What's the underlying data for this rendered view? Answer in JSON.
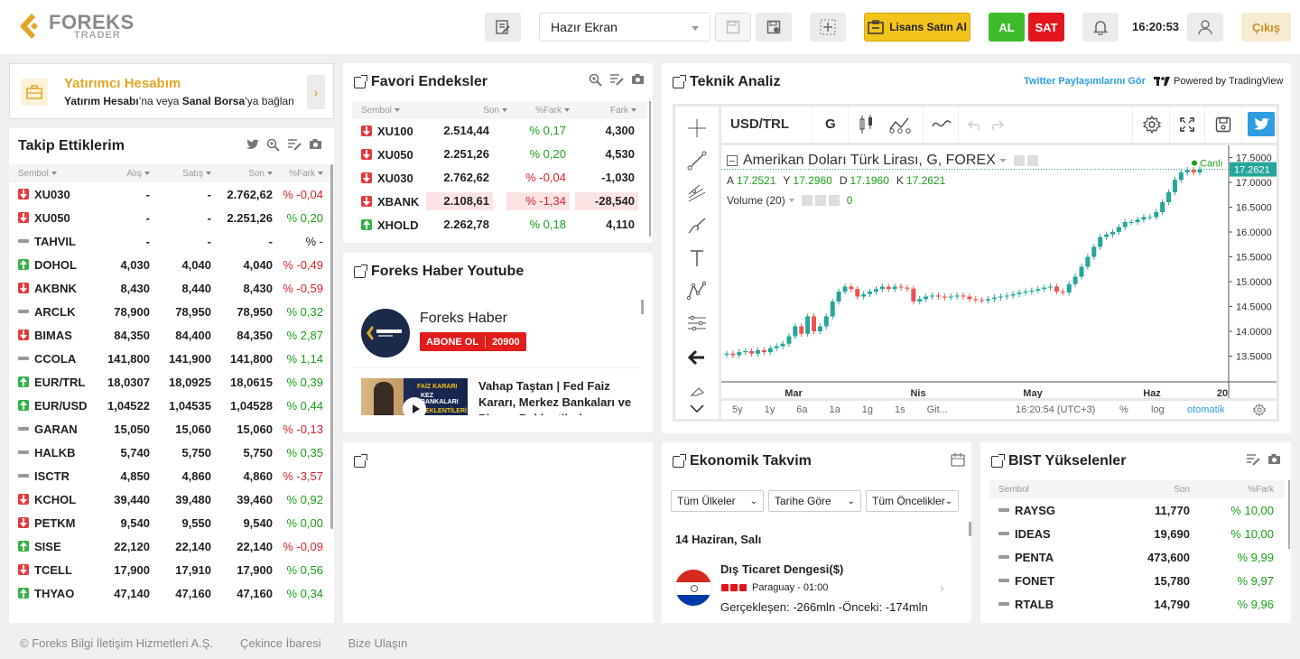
{
  "header": {
    "logo_main": "FOREKS",
    "logo_sub": "TRADER",
    "screen_select": "Hazır Ekran",
    "license_button": "Lisans Satın Al",
    "buy_button": "AL",
    "sell_button": "SAT",
    "clock": "16:20:53",
    "logout": "Çıkış",
    "colors": {
      "buy": "#3dbb2b",
      "sell": "#e3151e",
      "license": "#f2c31a",
      "gold": "#e0a526"
    }
  },
  "investor": {
    "title": "Yatırımcı Hesabım",
    "desc_part1": "Yatırım Hesabı",
    "desc_part2": "’na veya ",
    "desc_part3": "Sanal Borsa",
    "desc_part4": "’ya bağlan"
  },
  "watchlist": {
    "title": "Takip Ettiklerim",
    "columns": [
      "Sembol",
      "Alış",
      "Satış",
      "Son",
      "%Fark"
    ],
    "rows": [
      {
        "dir": "dn",
        "symbol": "XU030",
        "bid": "-",
        "ask": "-",
        "last": "2.762,62",
        "pct": "% -0,04",
        "sign": "neg"
      },
      {
        "dir": "dn",
        "symbol": "XU050",
        "bid": "-",
        "ask": "-",
        "last": "2.251,26",
        "pct": "% 0,20",
        "sign": "pos"
      },
      {
        "dir": "eq",
        "symbol": "TAHVIL",
        "bid": "-",
        "ask": "-",
        "last": "-",
        "pct": "% -",
        "sign": "flat"
      },
      {
        "dir": "up",
        "symbol": "DOHOL",
        "bid": "4,030",
        "ask": "4,040",
        "last": "4,040",
        "pct": "% -0,49",
        "sign": "neg"
      },
      {
        "dir": "dn",
        "symbol": "AKBNK",
        "bid": "8,430",
        "ask": "8,440",
        "last": "8,430",
        "pct": "% -0,59",
        "sign": "neg"
      },
      {
        "dir": "eq",
        "symbol": "ARCLK",
        "bid": "78,900",
        "ask": "78,950",
        "last": "78,950",
        "pct": "% 0,32",
        "sign": "pos"
      },
      {
        "dir": "dn",
        "symbol": "BIMAS",
        "bid": "84,350",
        "ask": "84,400",
        "last": "84,350",
        "pct": "% 2,87",
        "sign": "pos"
      },
      {
        "dir": "eq",
        "symbol": "CCOLA",
        "bid": "141,800",
        "ask": "141,900",
        "last": "141,800",
        "pct": "% 1,14",
        "sign": "pos"
      },
      {
        "dir": "up",
        "symbol": "EUR/TRL",
        "bid": "18,0307",
        "ask": "18,0925",
        "last": "18,0615",
        "pct": "% 0,39",
        "sign": "pos"
      },
      {
        "dir": "up",
        "symbol": "EUR/USD",
        "bid": "1,04522",
        "ask": "1,04535",
        "last": "1,04528",
        "pct": "% 0,44",
        "sign": "pos"
      },
      {
        "dir": "eq",
        "symbol": "GARAN",
        "bid": "15,050",
        "ask": "15,060",
        "last": "15,060",
        "pct": "% -0,13",
        "sign": "neg"
      },
      {
        "dir": "eq",
        "symbol": "HALKB",
        "bid": "5,740",
        "ask": "5,750",
        "last": "5,750",
        "pct": "% 0,35",
        "sign": "pos"
      },
      {
        "dir": "eq",
        "symbol": "ISCTR",
        "bid": "4,850",
        "ask": "4,860",
        "last": "4,860",
        "pct": "% -3,57",
        "sign": "neg"
      },
      {
        "dir": "dn",
        "symbol": "KCHOL",
        "bid": "39,440",
        "ask": "39,480",
        "last": "39,460",
        "pct": "% 0,92",
        "sign": "pos"
      },
      {
        "dir": "dn",
        "symbol": "PETKM",
        "bid": "9,540",
        "ask": "9,550",
        "last": "9,540",
        "pct": "% 0,00",
        "sign": "pos"
      },
      {
        "dir": "up",
        "symbol": "SISE",
        "bid": "22,120",
        "ask": "22,140",
        "last": "22,140",
        "pct": "% -0,09",
        "sign": "neg"
      },
      {
        "dir": "dn",
        "symbol": "TCELL",
        "bid": "17,900",
        "ask": "17,910",
        "last": "17,900",
        "pct": "% 0,56",
        "sign": "pos"
      },
      {
        "dir": "up",
        "symbol": "THYAO",
        "bid": "47,140",
        "ask": "47,160",
        "last": "47,160",
        "pct": "% 0,34",
        "sign": "pos"
      }
    ]
  },
  "favorites": {
    "title": "Favori Endeksler",
    "columns": [
      "Sembol",
      "Son",
      "%Fark",
      "Fark"
    ],
    "rows": [
      {
        "dir": "dn",
        "symbol": "XU100",
        "last": "2.514,44",
        "pct": "% 0,17",
        "diff": "4,300",
        "sign": "pos",
        "hl": false
      },
      {
        "dir": "dn",
        "symbol": "XU050",
        "last": "2.251,26",
        "pct": "% 0,20",
        "diff": "4,530",
        "sign": "pos",
        "hl": false
      },
      {
        "dir": "dn",
        "symbol": "XU030",
        "last": "2.762,62",
        "pct": "% -0,04",
        "diff": "-1,030",
        "sign": "neg",
        "hl": false
      },
      {
        "dir": "dn",
        "symbol": "XBANK",
        "last": "2.108,61",
        "pct": "% -1,34",
        "diff": "-28,540",
        "sign": "neg",
        "hl": true
      },
      {
        "dir": "up",
        "symbol": "XHOLD",
        "last": "2.262,78",
        "pct": "% 0,18",
        "diff": "4,110",
        "sign": "pos",
        "hl": false
      }
    ]
  },
  "youtube": {
    "title": "Foreks Haber Youtube",
    "channel": "Foreks Haber",
    "subscribe": "ABONE OL",
    "subs": "20900",
    "video_title": "Vahap Taştan | Fed Faiz Kararı, Merkez Bankaları ve Piyasa Beklentileri",
    "thumb_text1": "FAİZ KARARI",
    "thumb_text2": "KEZ BANKALARI",
    "thumb_text3": "A BEKLENTİLERİ"
  },
  "technical": {
    "title": "Teknik Analiz",
    "twitter_link": "Twitter Paylaşımlarını Gör",
    "powered": "Powered by TradingView",
    "symbol": "USD/TRL",
    "interval": "G",
    "chart_title": "Amerikan Doları Türk Lirası, G, FOREX",
    "ohlc": [
      {
        "k": "A",
        "v": "17.2521"
      },
      {
        "k": "Y",
        "v": "17.2960"
      },
      {
        "k": "D",
        "v": "17.1960"
      },
      {
        "k": "K",
        "v": "17.2621"
      }
    ],
    "volume_label": "Volume (20)",
    "volume_value": "0",
    "live_label": "Canlı",
    "last_price": "17.2621",
    "bottom": {
      "ranges": [
        "5y",
        "1y",
        "6a",
        "1a",
        "1g",
        "1s",
        "Git..."
      ],
      "time": "16:20:54 (UTC+3)",
      "pct": "%",
      "log": "log",
      "auto": "otomatik"
    }
  },
  "chart_data": {
    "type": "candlestick",
    "title": "Amerikan Doları Türk Lirası, G, FOREX",
    "x_tick_labels": [
      "Mar",
      "Nis",
      "May",
      "Haz",
      "20"
    ],
    "y_tick_labels": [
      "17.5000",
      "17.0000",
      "16.5000",
      "16.0000",
      "15.5000",
      "15.0000",
      "14.5000",
      "14.0000",
      "13.5000"
    ],
    "ylim": [
      13.2,
      17.6
    ],
    "approx_close": [
      13.55,
      13.52,
      13.58,
      13.6,
      13.55,
      13.62,
      13.58,
      13.66,
      13.7,
      13.75,
      13.9,
      14.1,
      13.95,
      14.3,
      14.0,
      14.1,
      14.3,
      14.6,
      14.8,
      14.9,
      14.85,
      14.7,
      14.75,
      14.8,
      14.85,
      14.9,
      14.85,
      14.9,
      14.88,
      14.86,
      14.6,
      14.65,
      14.7,
      14.72,
      14.7,
      14.68,
      14.7,
      14.72,
      14.7,
      14.65,
      14.63,
      14.62,
      14.65,
      14.68,
      14.7,
      14.72,
      14.75,
      14.78,
      14.8,
      14.82,
      14.85,
      14.88,
      14.9,
      14.8,
      14.78,
      14.95,
      15.1,
      15.3,
      15.5,
      15.7,
      15.9,
      15.95,
      16.0,
      16.1,
      16.2,
      16.2,
      16.25,
      16.3,
      16.3,
      16.4,
      16.6,
      16.8,
      17.05,
      17.2,
      17.25,
      17.2,
      17.26
    ]
  },
  "ekonomik": {
    "title": "Ekonomik Takvim",
    "filters": [
      "Tüm Ülkeler",
      "Tarihe Göre",
      "Tüm Öncelikler"
    ],
    "date": "14 Haziran, Salı",
    "event": "Dış Ticaret Dengesi($)",
    "country_time": "Paraguay - 01:00",
    "result": "Gerçekleşen: -266mln -Önceki: -174mln"
  },
  "rising": {
    "title": "BIST Yükselenler",
    "columns": [
      "Sembol",
      "Son",
      "%Fark"
    ],
    "rows": [
      {
        "symbol": "RAYSG",
        "last": "11,770",
        "pct": "% 10,00"
      },
      {
        "symbol": "IDEAS",
        "last": "19,690",
        "pct": "% 10,00"
      },
      {
        "symbol": "PENTA",
        "last": "473,600",
        "pct": "% 9,99"
      },
      {
        "symbol": "FONET",
        "last": "15,780",
        "pct": "% 9,97"
      },
      {
        "symbol": "RTALB",
        "last": "14,790",
        "pct": "% 9,96"
      }
    ]
  },
  "footer": {
    "copyright": "© Foreks Bilgi İletişim Hizmetleri A.Ş.",
    "disclaimer": "Çekince İbaresi",
    "contact": "Bize Ulaşın"
  }
}
